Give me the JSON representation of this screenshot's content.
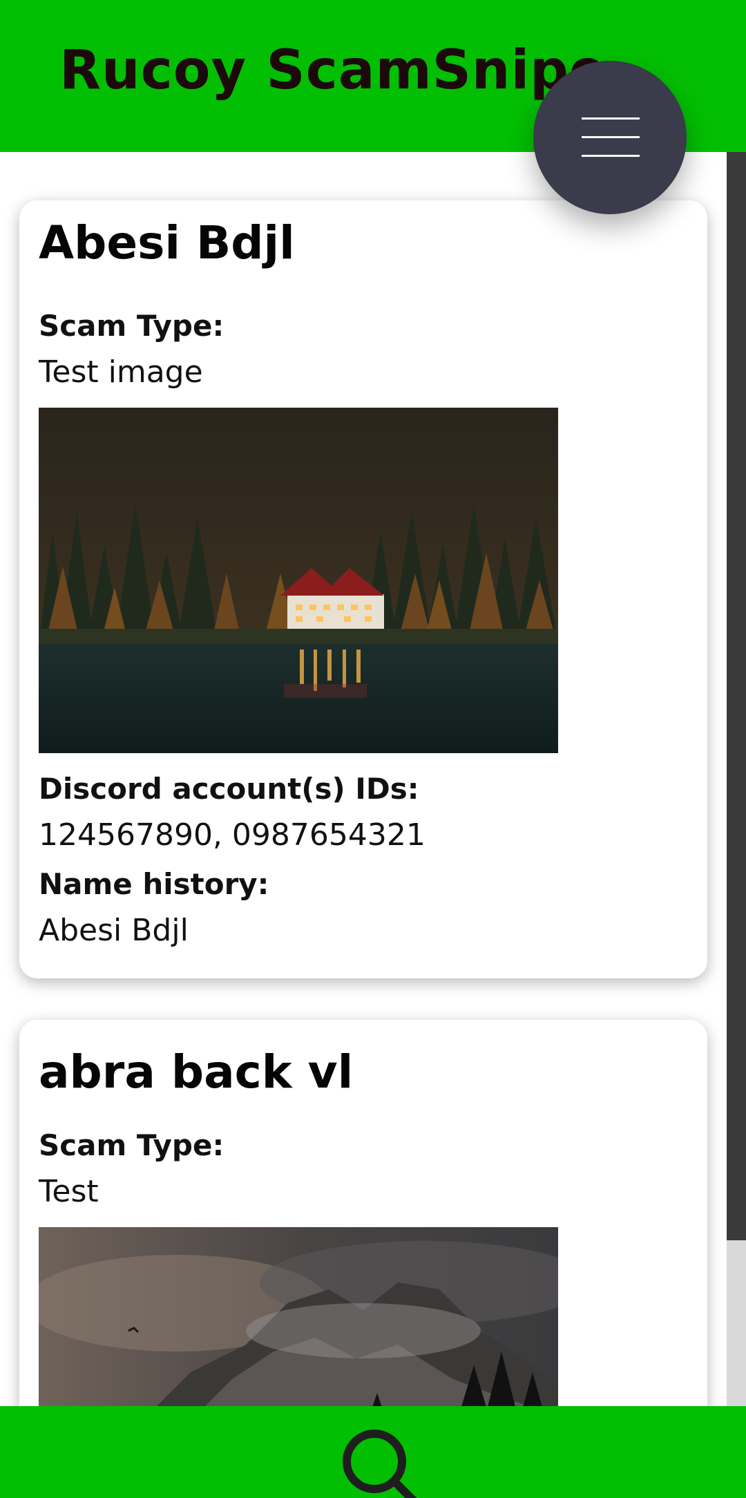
{
  "app": {
    "title": "Rucoy ScamSnipe"
  },
  "colors": {
    "header": "#03bf03",
    "menu_button": "#3a3b4b",
    "title_text": "#1c0a0a"
  },
  "icons": {
    "menu": "hamburger-menu-icon",
    "search": "search-icon"
  },
  "entries": [
    {
      "name": "Abesi Bdjl",
      "scam_type_label": "Scam Type:",
      "scam_type": "Test image",
      "image": "lakeside-house-forest-photo",
      "discord_label": "Discord account(s) IDs:",
      "discord_ids": "124567890, 0987654321",
      "name_history_label": "Name history:",
      "name_history": "Abesi Bdjl"
    },
    {
      "name": "abra back vl",
      "scam_type_label": "Scam Type:",
      "scam_type": "Test",
      "image": "foggy-mountain-photo"
    }
  ]
}
